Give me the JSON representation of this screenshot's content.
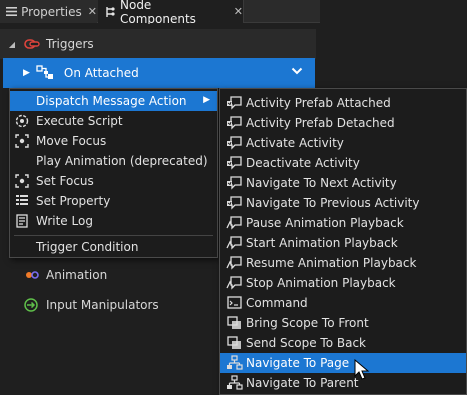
{
  "tabs": [
    {
      "label": "Properties",
      "icon": "properties-icon",
      "active": false
    },
    {
      "label": "Node Components",
      "icon": "node-components-icon",
      "active": true
    }
  ],
  "triggers": {
    "label": "Triggers",
    "icon": "triggers-icon"
  },
  "selected_trigger": {
    "label": "On Attached",
    "icon": "trigger-node-icon"
  },
  "animation": {
    "label": "Animation",
    "icon": "animation-icon"
  },
  "input_manipulators": {
    "label": "Input Manipulators",
    "icon": "input-manipulators-icon"
  },
  "action_menu": {
    "items": [
      {
        "label": "Dispatch Message Action",
        "icon": "",
        "has_submenu": true,
        "highlighted": true
      },
      {
        "label": "Execute Script",
        "icon": "execute-script-icon"
      },
      {
        "label": "Move Focus",
        "icon": "move-focus-icon"
      },
      {
        "label": "Play Animation (deprecated)",
        "icon": ""
      },
      {
        "label": "Set Focus",
        "icon": "set-focus-icon"
      },
      {
        "label": "Set Property",
        "icon": "set-property-icon"
      },
      {
        "label": "Write Log",
        "icon": "write-log-icon"
      }
    ],
    "footer_item": {
      "label": "Trigger Condition"
    }
  },
  "dispatch_submenu": {
    "items": [
      {
        "label": "Activity Prefab Attached",
        "icon": "message-icon"
      },
      {
        "label": "Activity Prefab Detached",
        "icon": "message-icon"
      },
      {
        "label": "Activate Activity",
        "icon": "message-icon"
      },
      {
        "label": "Deactivate Activity",
        "icon": "message-icon"
      },
      {
        "label": "Navigate To Next Activity",
        "icon": "message-icon"
      },
      {
        "label": "Navigate To Previous Activity",
        "icon": "message-icon"
      },
      {
        "label": "Pause Animation Playback",
        "icon": "animation-message-icon"
      },
      {
        "label": "Start Animation Playback",
        "icon": "animation-message-icon"
      },
      {
        "label": "Resume Animation Playback",
        "icon": "animation-message-icon"
      },
      {
        "label": "Stop Animation Playback",
        "icon": "animation-message-icon"
      },
      {
        "label": "Command",
        "icon": "command-icon"
      },
      {
        "label": "Bring Scope To Front",
        "icon": "scope-icon"
      },
      {
        "label": "Send Scope To Back",
        "icon": "scope-icon"
      },
      {
        "label": "Navigate To Page",
        "icon": "navigation-icon",
        "highlighted": true
      },
      {
        "label": "Navigate To Parent",
        "icon": "navigation-icon"
      }
    ]
  },
  "colors": {
    "selection": "#1c77d2",
    "background": "#1f1f1f",
    "menu_bg": "#1c1c1c",
    "text": "#e2e2e2"
  }
}
